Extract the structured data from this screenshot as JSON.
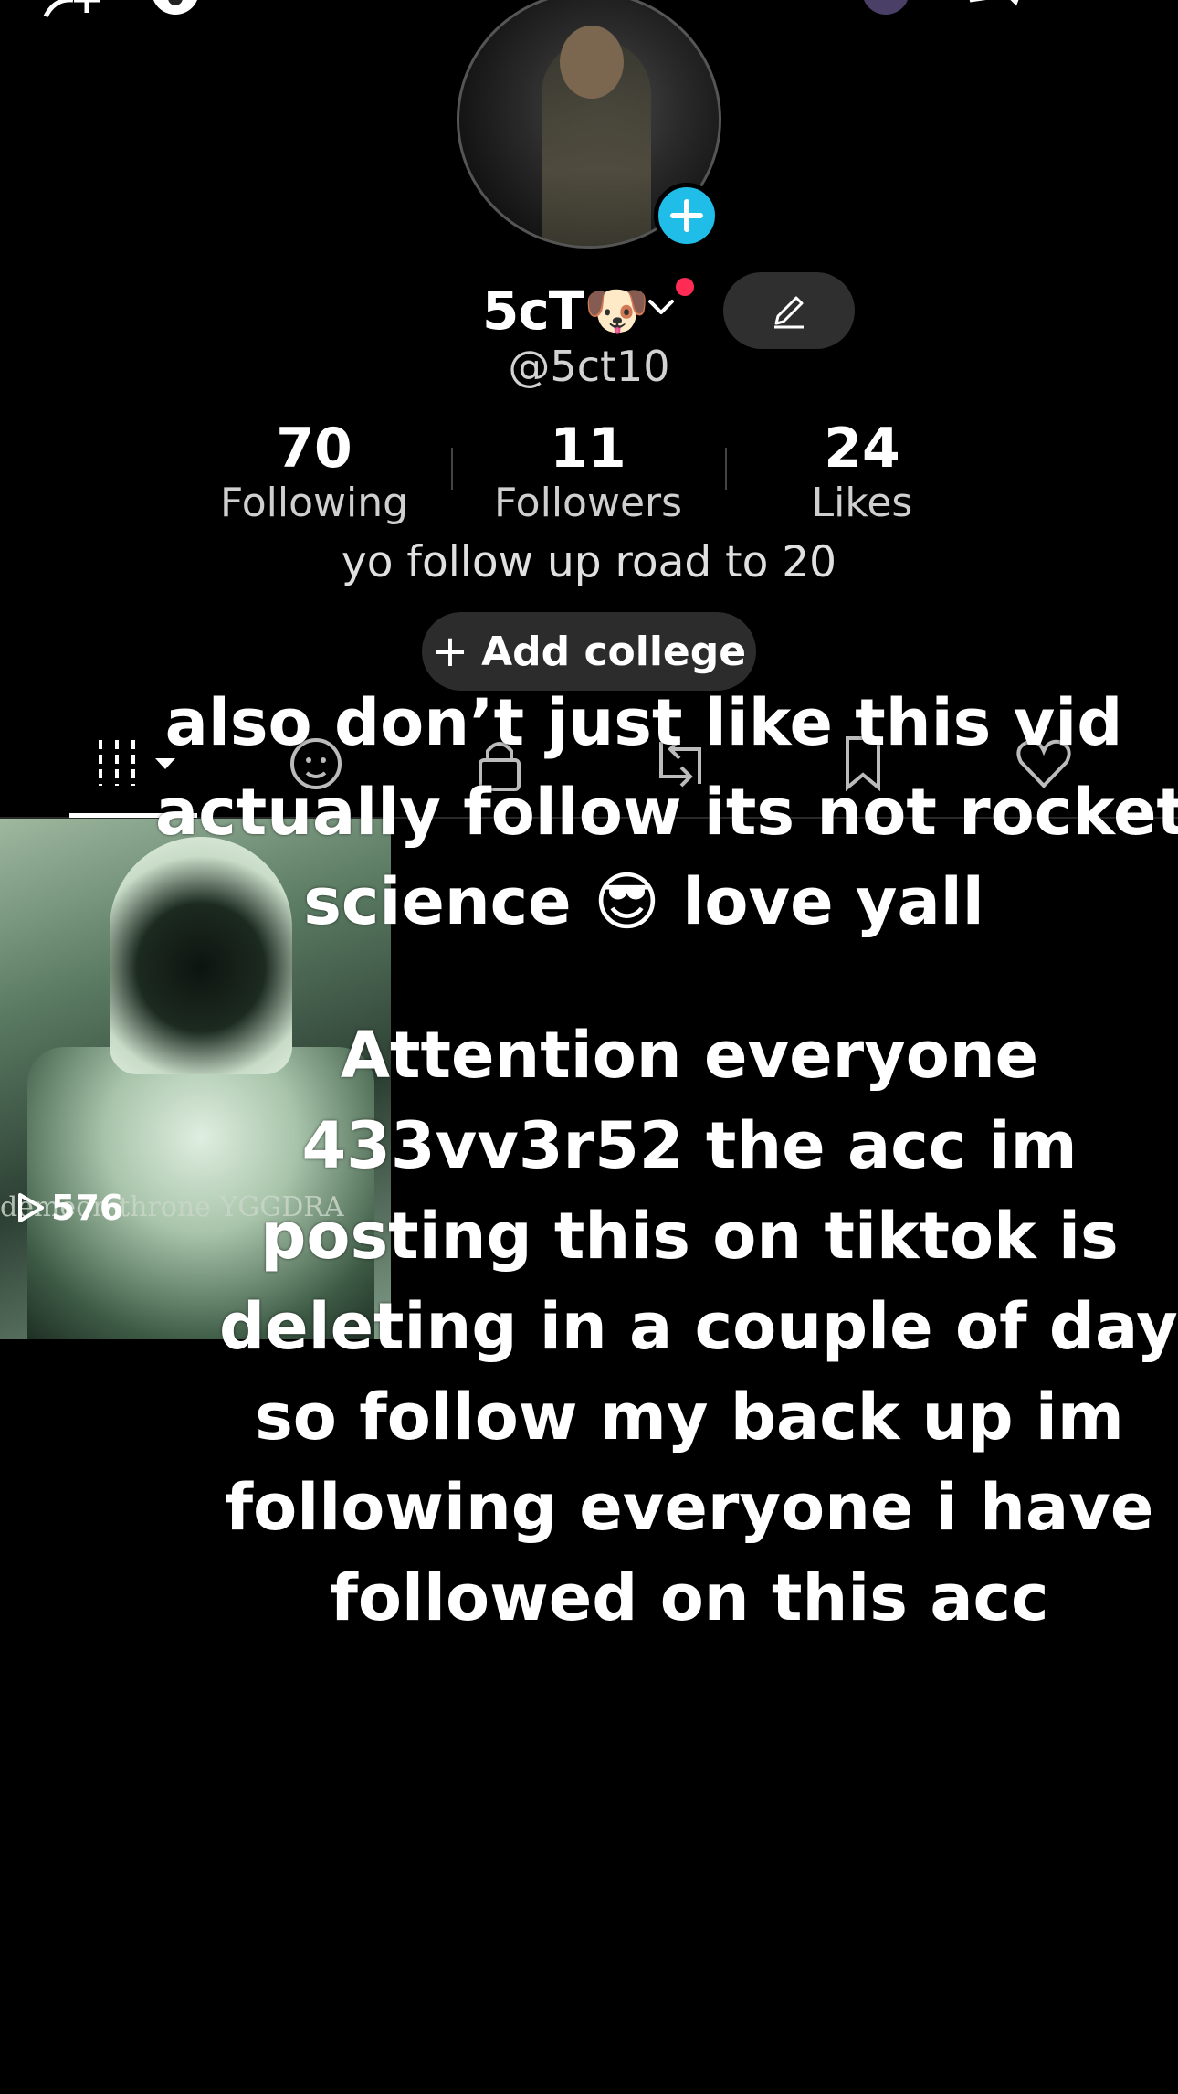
{
  "profile": {
    "display_name": "5cT🐶",
    "handle": "@5ct10",
    "bio": "yo follow up road to 20",
    "add_college_label": "Add college"
  },
  "stats": [
    {
      "value": "70",
      "label": "Following"
    },
    {
      "value": "11",
      "label": "Followers"
    },
    {
      "value": "24",
      "label": "Likes"
    }
  ],
  "tabs": [
    "videos-grid-icon",
    "reposts-face-icon",
    "private-lock-icon",
    "repost-arrows-icon",
    "favorites-bookmark-icon",
    "liked-heart-icon"
  ],
  "video": {
    "views": "576",
    "caption_fragment": "demeon throne YGGDRA"
  },
  "overlay_text": {
    "line1": [
      "also don’t  just like this vid",
      "actually follow its not rocket",
      "science 😎 love yall"
    ],
    "line2": [
      "Attention everyone",
      "433vv3r52 the acc im",
      "posting this on tiktok is",
      "deleting in a couple of days",
      "so follow my back up im",
      "following everyone i have",
      "followed on this acc"
    ]
  },
  "colors": {
    "accent_blue": "#20bde8",
    "notify_red": "#fe2c55"
  }
}
